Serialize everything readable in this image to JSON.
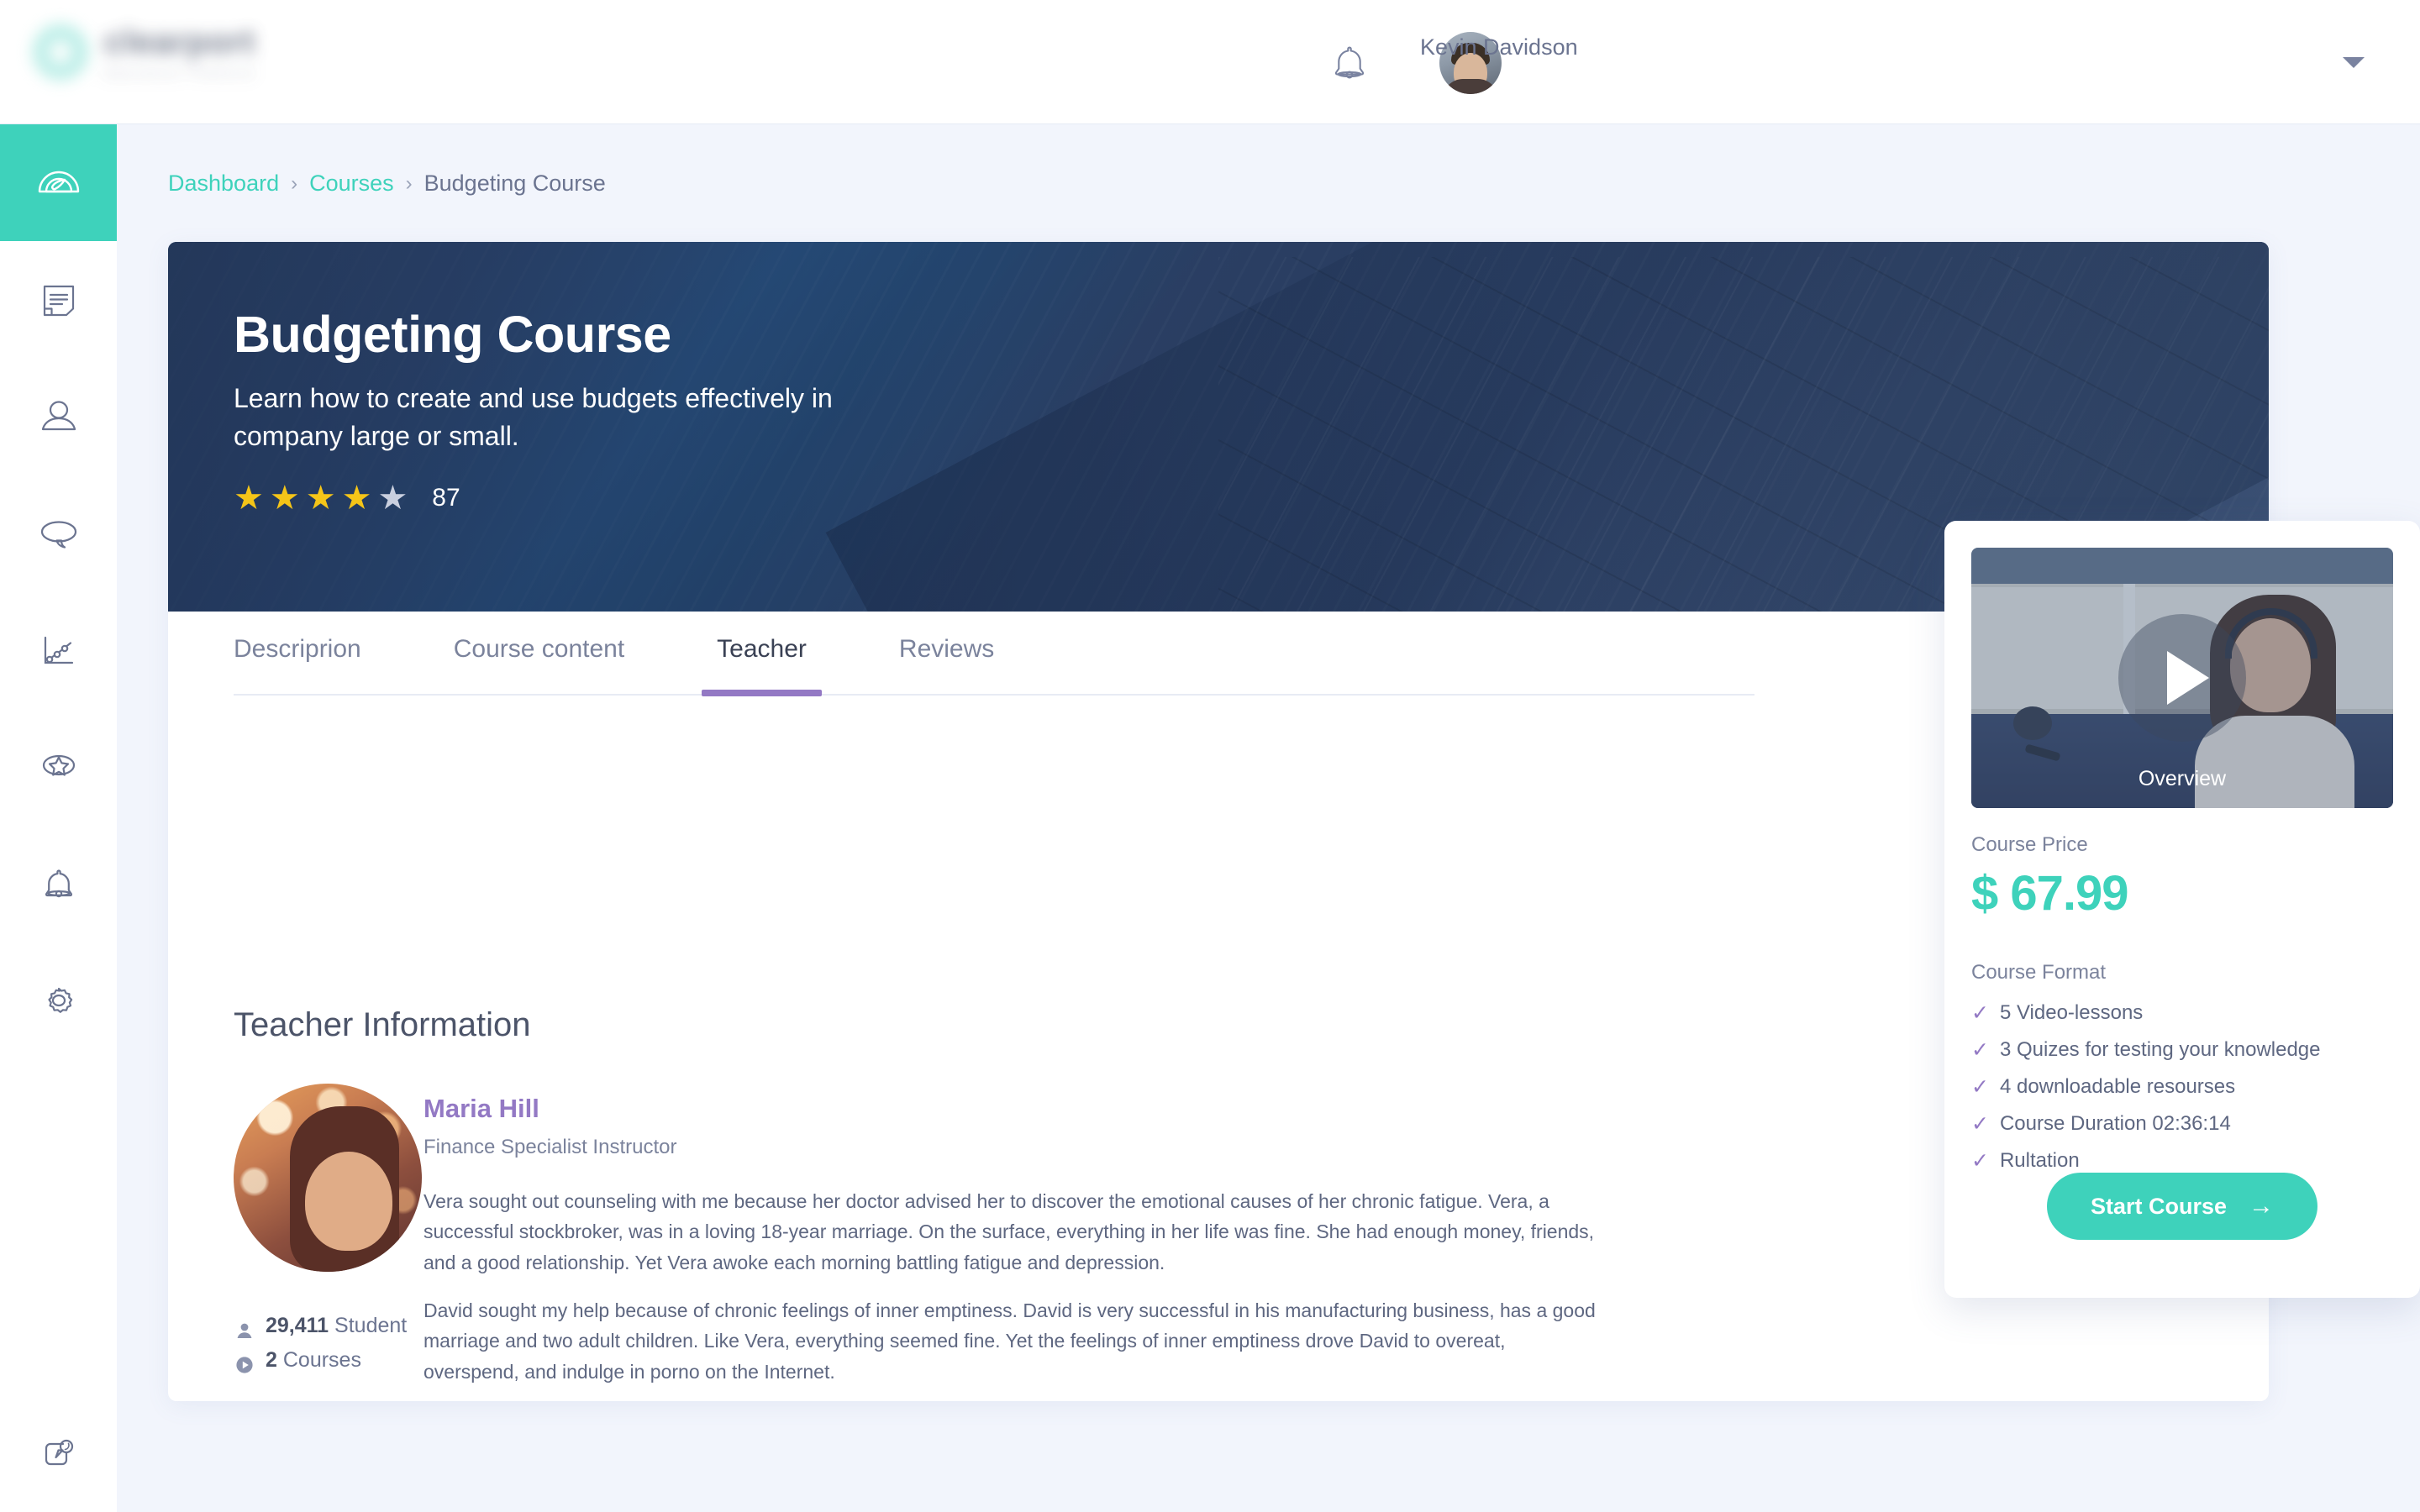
{
  "header": {
    "logo": {
      "name": "clearport",
      "tagline": "Education Platform",
      "icon": "logo-mark"
    },
    "notification_icon": "bell-icon",
    "user": {
      "first_name": "Kevin",
      "last_name": "Davidson",
      "full_name": "Kevin\nDavidson"
    },
    "caret_icon": "chevron-down-icon"
  },
  "sidebar": {
    "items": [
      {
        "icon": "dashboard-gauge-icon",
        "active": true
      },
      {
        "icon": "document-icon",
        "active": false
      },
      {
        "icon": "user-icon",
        "active": false
      },
      {
        "icon": "chat-bubble-icon",
        "active": false
      },
      {
        "icon": "analytics-chart-icon",
        "active": false
      },
      {
        "icon": "star-badge-icon",
        "active": false
      },
      {
        "icon": "bell-icon",
        "active": false
      },
      {
        "icon": "gear-icon",
        "active": false
      }
    ],
    "bottom_item": {
      "icon": "pin-board-icon"
    }
  },
  "breadcrumb": {
    "items": [
      {
        "label": "Dashboard",
        "link": true
      },
      {
        "label": "Courses",
        "link": true
      },
      {
        "label": "Budgeting Course",
        "link": false
      }
    ],
    "separator": "›"
  },
  "hero": {
    "title": "Budgeting Course",
    "subtitle": "Learn how to create and use budgets effectively in company large or small.",
    "rating": {
      "stars_filled": 4,
      "stars_total": 5,
      "count": "87"
    }
  },
  "tabs": [
    {
      "label": "Descriprion",
      "active": false
    },
    {
      "label": "Course content",
      "active": false
    },
    {
      "label": "Teacher",
      "active": true
    },
    {
      "label": "Reviews",
      "active": false
    }
  ],
  "teacher_section": {
    "section_title": "Teacher Information",
    "name": "Maria Hill",
    "role": "Finance Specialist Instructor",
    "paragraph_1": "Vera sought out counseling with me because her doctor advised her to discover the emotional causes of her chronic fatigue. Vera, a successful stockbroker, was in a loving 18-year marriage. On the surface, everything in her life was fine. She had enough money, friends, and a good relationship. Yet Vera awoke each morning battling fatigue and depression.",
    "paragraph_2": "David sought my help because of chronic feelings of inner emptiness. David is very successful in his manufacturing business, has a good marriage and two adult children. Like Vera, everything seemed fine. Yet the feelings of inner emptiness drove David to overeat, overspend, and indulge in porno on the Internet.",
    "stats": {
      "students_value": "29,411",
      "students_label": "Student",
      "courses_value": "2",
      "courses_label": "Courses",
      "students_icon": "person-icon",
      "courses_icon": "play-circle-icon"
    }
  },
  "overview_card": {
    "video": {
      "label": "Overview",
      "play_icon": "play-icon"
    },
    "price_label": "Course Price",
    "price": "$ 67.99",
    "format_label": "Course Format",
    "features": [
      "5 Video-lessons",
      "3 Quizes for testing your knowledge",
      "4 downloadable resourses",
      "Course Duration 02:36:14",
      "Rultation"
    ],
    "check_icon": "check-icon",
    "cta": {
      "label": "Start Course",
      "icon": "arrow-right-icon"
    }
  },
  "colors": {
    "accent_teal": "#3ED2BB",
    "accent_purple": "#9379C4",
    "star_gold": "#F5C518",
    "star_gray": "#C9CFDF",
    "text_muted": "#7B839C",
    "page_bg": "#F2F5FC",
    "hero_bg": "#2B4468"
  }
}
